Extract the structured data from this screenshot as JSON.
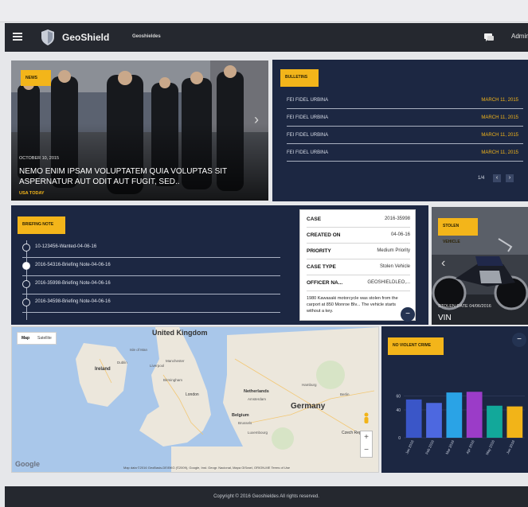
{
  "header": {
    "brand": "GeoShield",
    "nav_link": "Geoshieldes",
    "user_label": "Admin"
  },
  "news": {
    "tag": "NEWS",
    "date": "OCTOBER 10, 2015",
    "title": "NEMO ENIM IPSAM VOLUPTATEM QUIA VOLUPTAS SIT ASPERNATUR AUT ODIT AUT FUGIT, SED..",
    "source": "USA TODAY"
  },
  "bulletins": {
    "tag": "BULLETINS",
    "items": [
      {
        "name": "FEI FIDEL URBINA",
        "date": "MARCH 11, 2015"
      },
      {
        "name": "FEI FIDEL URBINA",
        "date": "MARCH 11, 2015"
      },
      {
        "name": "FEI FIDEL URBINA",
        "date": "MARCH 11, 2015"
      },
      {
        "name": "FEI FIDEL URBINA",
        "date": "MARCH 11, 2015"
      }
    ],
    "pager": "1/4",
    "prev": "‹",
    "next": "›"
  },
  "briefing": {
    "tag": "BRIEFING NOTE",
    "items": [
      "10-123456-Wanted-04-06-16",
      "2016-54316-Briefing Note-04-06-16",
      "2016-35998-Briefing Note-04-06-16",
      "2016-34598-Briefing Note-04-06-16"
    ]
  },
  "case_card": {
    "rows": [
      {
        "label": "CASE",
        "value": "2016-35998"
      },
      {
        "label": "CREATED ON",
        "value": "04-06-16"
      },
      {
        "label": "PRIORITY",
        "value": "Medium Priority"
      },
      {
        "label": "CASE TYPE",
        "value": "Stolen Vehicle"
      },
      {
        "label": "OFFICER NA...",
        "value": "GEOSHIELDLEO,..."
      }
    ],
    "description": "1980 Kawasaki motorcycle was stolen from the carport at 850 Monroe Blv... The vehicle starts without a key.",
    "fab": "−"
  },
  "vehicle": {
    "tag": "STOLEN VEHICLE",
    "date": "STOLEN DATE 04/06/2016",
    "vin": "VIN"
  },
  "map": {
    "tab_map": "Map",
    "tab_satellite": "Satellite",
    "labels": [
      "United Kingdom",
      "Isle of Man",
      "Ireland",
      "Dublin",
      "Liverpool",
      "Manchester",
      "Birmingham",
      "London",
      "Netherlands",
      "Amsterdam",
      "Belgium",
      "Brussels",
      "Germany",
      "Berlin",
      "Hamburg",
      "Luxembourg",
      "Czech Rep"
    ],
    "zoom_in": "+",
    "zoom_out": "−",
    "google": "Google",
    "attribution": "Map data ©2016 GeoBasis-DE/BKG (©2009), Google, Inst. Geogr. Nacional, Mapa GISrael, ORION-ME   Terms of Use"
  },
  "crime": {
    "tag": "NO VIOLENT CRIME",
    "fab": "−"
  },
  "chart_data": {
    "type": "bar",
    "title": "",
    "categories": [
      "Jan 2016",
      "Feb 2016",
      "Mar 2016",
      "Apr 2016",
      "May 2016",
      "Jun 2016"
    ],
    "values": [
      55,
      50,
      65,
      66,
      46,
      45
    ],
    "colors": [
      "#3a56c8",
      "#4d68e0",
      "#2aa3e6",
      "#9b3cc8",
      "#12a89a",
      "#f2b418"
    ],
    "yticks": [
      "0",
      "40",
      "60"
    ],
    "ylim": [
      0,
      80
    ],
    "xlabel": "",
    "ylabel": ""
  },
  "footer": {
    "text": "Copyright © 2016 Geoshieldes All rights reserved."
  }
}
